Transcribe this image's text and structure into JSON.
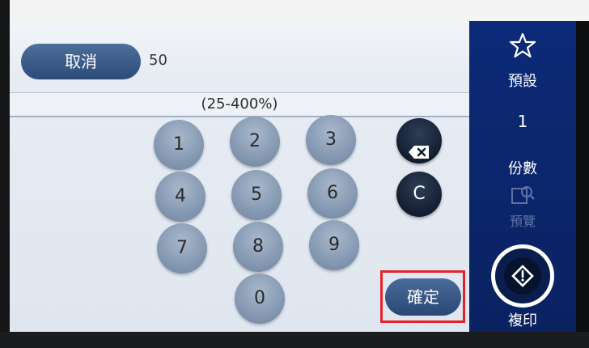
{
  "header": {
    "cancel_label": "取消",
    "entry_value": "50"
  },
  "range_hint": "(25-400%)",
  "keypad": {
    "keys": [
      "1",
      "2",
      "3",
      "4",
      "5",
      "6",
      "7",
      "8",
      "9",
      "0"
    ],
    "clear_label": "C",
    "confirm_label": "確定"
  },
  "sidebar": {
    "preset_label": "預設",
    "copies_value": "1",
    "copies_label": "份數",
    "preview_label": "預覽",
    "copy_label": "複印"
  },
  "colors": {
    "sidebar_bg": "#0c2a78",
    "key_bg": "#8a9db6",
    "action_bg": "#10192a",
    "highlight_outline": "#e1242b"
  },
  "icons": {
    "preset": "star-icon",
    "backspace": "backspace-icon",
    "preview": "preview-icon",
    "copy_start": "start-diamond-icon"
  }
}
